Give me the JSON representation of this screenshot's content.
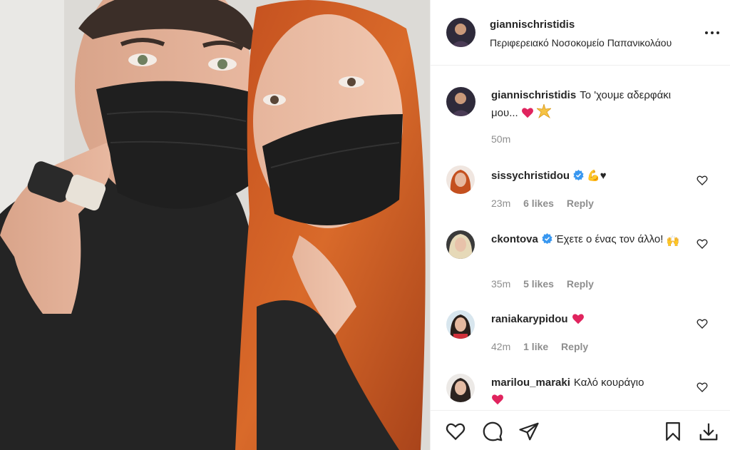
{
  "post": {
    "username": "giannischristidis",
    "location": "Περιφερειακό Νοσοκομείο Παπανικολάου"
  },
  "caption": {
    "username": "giannischristidis",
    "text": "Το 'χουμε αδερφάκι μου...",
    "time": "50m"
  },
  "comments": [
    {
      "username": "sissychristidou",
      "verified": true,
      "text": "",
      "time": "23m",
      "likes": "6 likes",
      "reply": "Reply",
      "emoji": "💪♥"
    },
    {
      "username": "ckontova",
      "verified": true,
      "text": "Έχετε ο ένας τον άλλο!",
      "time": "35m",
      "likes": "5 likes",
      "reply": "Reply",
      "emoji": "🙌"
    },
    {
      "username": "raniakarypidou",
      "verified": false,
      "text": "",
      "time": "42m",
      "likes": "1 like",
      "reply": "Reply",
      "emoji": "❤"
    },
    {
      "username": "marilou_maraki",
      "verified": false,
      "text": "Καλό κουράγιο",
      "time": "",
      "likes": "",
      "reply": "",
      "emoji": "❤"
    }
  ],
  "icons": {
    "more": "more-options-icon",
    "like": "heart-icon",
    "comment": "comment-icon",
    "share": "share-icon",
    "save": "bookmark-icon",
    "download": "download-icon"
  },
  "colors": {
    "text": "#262626",
    "secondary": "#8e8e8e",
    "verified": "#3897f0",
    "heart": "#ed4956",
    "border": "#efefef"
  }
}
